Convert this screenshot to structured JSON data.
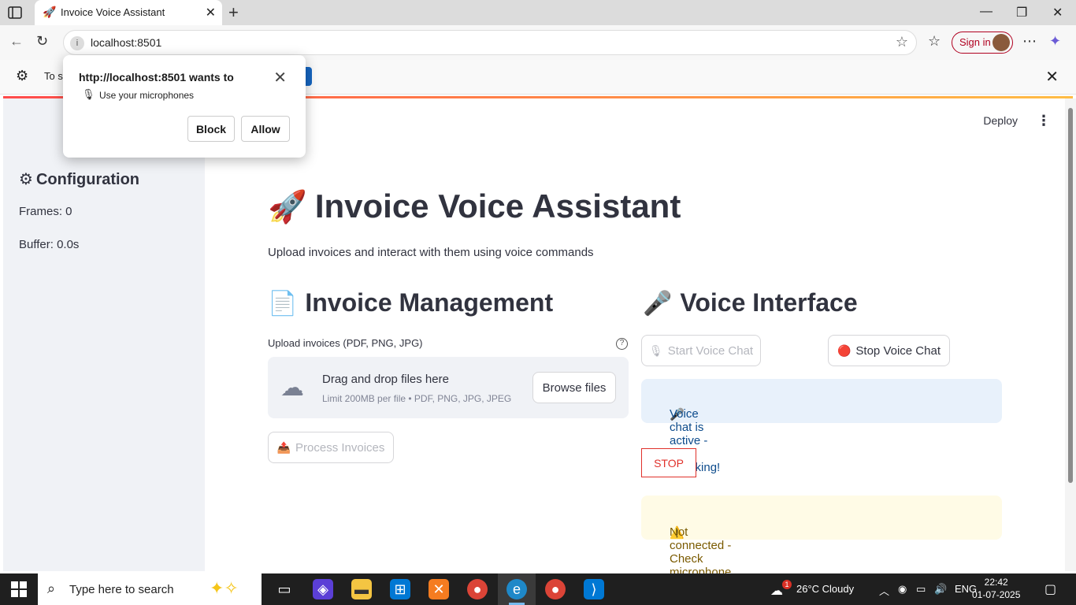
{
  "browser": {
    "tab_title": "Invoice Voice Assistant",
    "url": "localhost:8501",
    "sign_in_label": "Sign in",
    "infobar_text": "To s"
  },
  "permission_popup": {
    "title": "http://localhost:8501 wants to",
    "request": "Use your microphones",
    "block_label": "Block",
    "allow_label": "Allow"
  },
  "app": {
    "deploy_label": "Deploy",
    "title": "Invoice Voice Assistant",
    "subtitle": "Upload invoices and interact with them using voice commands"
  },
  "sidebar": {
    "title": "Configuration",
    "frames": "Frames: 0",
    "buffer": "Buffer: 0.0s"
  },
  "invoice_section": {
    "heading": "Invoice Management",
    "upload_label": "Upload invoices (PDF, PNG, JPG)",
    "drop_text": "Drag and drop files here",
    "limit_text": "Limit 200MB per file • PDF, PNG, JPG, JPEG",
    "browse_label": "Browse files",
    "process_label": "Process Invoices"
  },
  "voice_section": {
    "heading": "Voice Interface",
    "start_label": "Start Voice Chat",
    "stop_chat_label": "Stop Voice Chat",
    "active_message": "Voice chat is active - Start speaking!",
    "stop_label": "STOP",
    "warning_message": "Not connected - Check microphone permissions"
  },
  "taskbar": {
    "search_placeholder": "Type here to search",
    "weather": "26°C  Cloudy",
    "language": "ENG",
    "time": "22:42",
    "date": "01-07-2025",
    "weather_badge": "1"
  },
  "colors": {
    "accent_red": "#ff4b4b",
    "info_bg": "#e8f1fb",
    "warning_bg": "#fffbe6",
    "stop_red": "#e0312b"
  }
}
